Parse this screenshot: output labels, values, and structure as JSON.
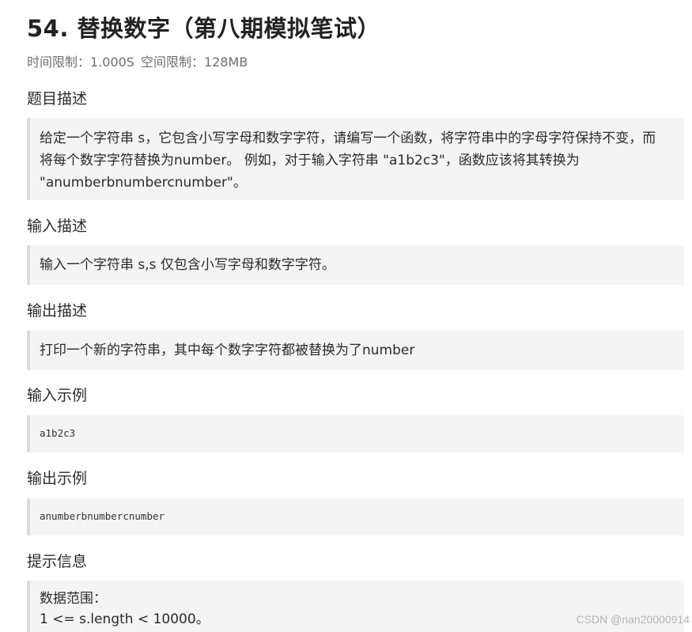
{
  "problem": {
    "title": "54. 替换数字（第八期模拟笔试）",
    "time_limit": "时间限制：1.000S",
    "space_limit": "空间限制：128MB"
  },
  "sections": {
    "description": {
      "heading": "题目描述",
      "lines": [
        "给定一个字符串 s，它包含小写字母和数字字符，请编写一个函数，将字符串中的字母字符保持不变，而",
        "将每个数字字符替换为number。 例如，对于输入字符串 \"a1b2c3\"，函数应该将其转换为",
        "\"anumberbnumbercnumber\"。"
      ]
    },
    "input_desc": {
      "heading": "输入描述",
      "text": "输入一个字符串 s,s 仅包含小写字母和数字字符。"
    },
    "output_desc": {
      "heading": "输出描述",
      "text": "打印一个新的字符串，其中每个数字字符都被替换为了number"
    },
    "input_example": {
      "heading": "输入示例",
      "code": "a1b2c3"
    },
    "output_example": {
      "heading": "输出示例",
      "code": "anumberbnumbercnumber"
    },
    "hints": {
      "heading": "提示信息",
      "lines": [
        "数据范围：",
        "1 <= s.length < 10000。"
      ]
    }
  },
  "watermark": "CSDN @nan20000914"
}
